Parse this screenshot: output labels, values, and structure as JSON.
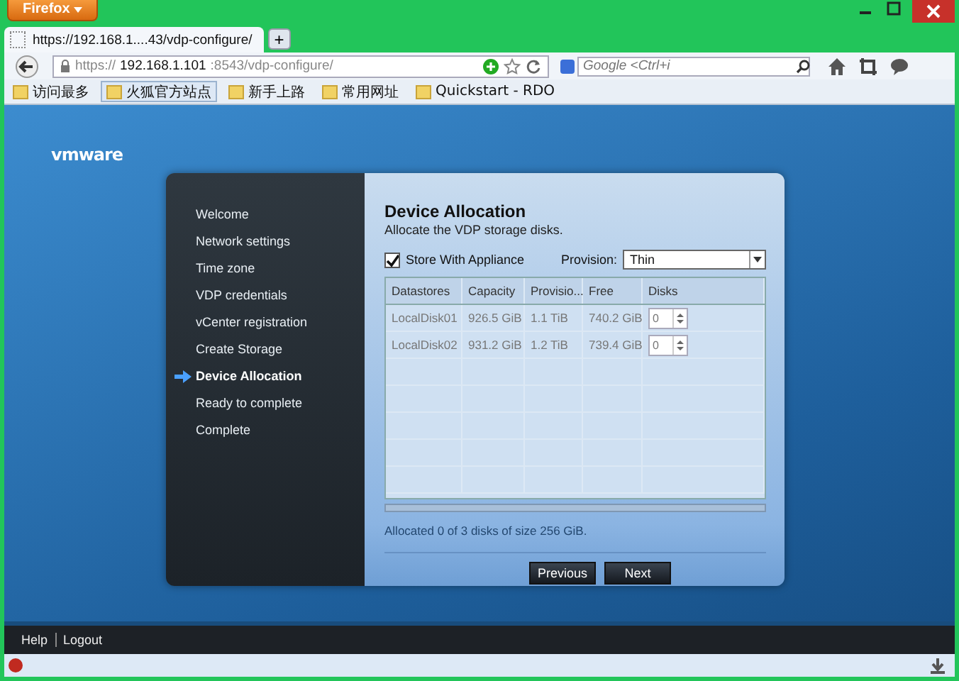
{
  "browser": {
    "menu_button": "Firefox",
    "tab_title": "https://192.168.1....43/vdp-configure/",
    "new_tab": "+",
    "url": {
      "scheme": "https://",
      "host": "192.168.1.101",
      "path": ":8543/vdp-configure/"
    },
    "search_placeholder": "Google <Ctrl+i",
    "bookmarks": [
      {
        "label": "访问最多",
        "selected": false
      },
      {
        "label": "火狐官方站点",
        "selected": true
      },
      {
        "label": "新手上路",
        "selected": false
      },
      {
        "label": "常用网址",
        "selected": false
      },
      {
        "label": "Quickstart - RDO",
        "selected": false
      }
    ]
  },
  "app": {
    "logo": "vmware",
    "steps": [
      {
        "label": "Welcome",
        "selected": false
      },
      {
        "label": "Network settings",
        "selected": false
      },
      {
        "label": "Time zone",
        "selected": false
      },
      {
        "label": "VDP credentials",
        "selected": false
      },
      {
        "label": "vCenter registration",
        "selected": false
      },
      {
        "label": "Create Storage",
        "selected": false
      },
      {
        "label": "Device Allocation",
        "selected": true
      },
      {
        "label": "Ready to complete",
        "selected": false
      },
      {
        "label": "Complete",
        "selected": false
      }
    ],
    "title": "Device Allocation",
    "subtitle": "Allocate the VDP storage disks.",
    "store_with_appliance": {
      "label": "Store With Appliance",
      "checked": true
    },
    "provision": {
      "label": "Provision:",
      "value": "Thin"
    },
    "table": {
      "columns": [
        "Datastores",
        "Capacity",
        "Provisio...",
        "Free",
        "Disks"
      ],
      "rows": [
        {
          "datastore": "LocalDisk01",
          "capacity": "926.5 GiB",
          "provisioned": "1.1 TiB",
          "free": "740.2 GiB",
          "disks": "0"
        },
        {
          "datastore": "LocalDisk02",
          "capacity": "931.2 GiB",
          "provisioned": "1.2 TiB",
          "free": "739.4 GiB",
          "disks": "0"
        }
      ]
    },
    "allocation": {
      "level": 0,
      "status": "Allocated 0 of 3 disks of size 256 GiB."
    },
    "buttons": [
      "Previous",
      "Next"
    ],
    "footer_links": [
      "Help",
      "Logout"
    ]
  }
}
